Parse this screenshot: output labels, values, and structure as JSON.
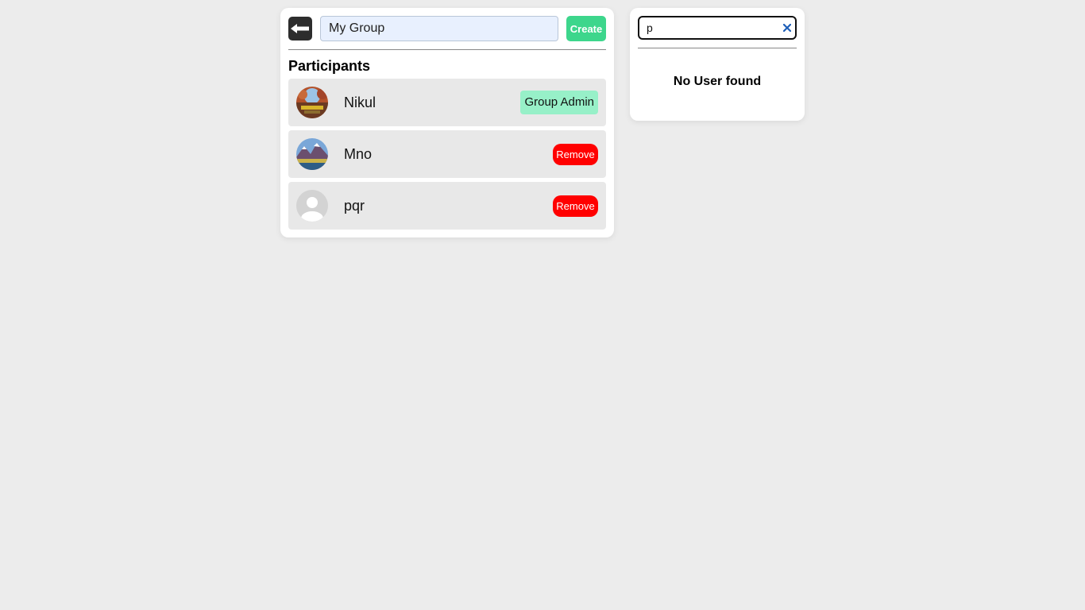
{
  "group": {
    "back_icon": "arrow-left-icon",
    "name_value": "My Group",
    "create_label": "Create",
    "participants_title": "Participants",
    "participants": [
      {
        "name": "Nikul",
        "avatar": "photo-canyon",
        "role_label": "Group Admin"
      },
      {
        "name": "Mno",
        "avatar": "photo-mountains",
        "action_label": "Remove"
      },
      {
        "name": "pqr",
        "avatar": "default-user-icon",
        "action_label": "Remove"
      }
    ]
  },
  "search": {
    "value": "p",
    "clear_icon": "close-icon",
    "empty_message": "No User found"
  },
  "colors": {
    "background": "#ececec",
    "create_button": "#3dd68c",
    "admin_badge": "#97f0c8",
    "remove_button": "#ff0000",
    "row_background": "#e8e8e8",
    "back_button": "#2d2d2d",
    "clear_icon": "#1e5fb8"
  }
}
